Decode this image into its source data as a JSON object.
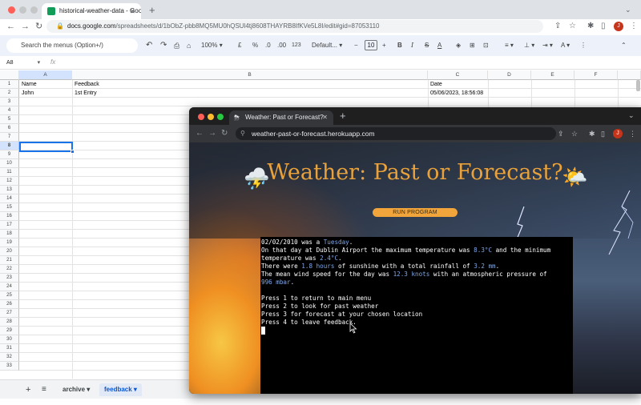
{
  "browser": {
    "tab_title": "historical-weather-data - Goo",
    "url_host": "docs.google.com",
    "url_path": "/spreadsheets/d/1bObZ-pbb8MQ5MU0hQSUl4tj8608THAYRB8IfKVe5L8I/edit#gid=87053110",
    "avatar_letter": "J"
  },
  "sheets": {
    "menu_search": "Search the menus (Option+/)",
    "zoom": "100%",
    "currency": "£",
    "percent": "%",
    "dec_decrease": ".0",
    "dec_increase": ".00",
    "number_format": "123",
    "font": "Default...",
    "font_size": "10",
    "name_box": "A8",
    "fx": "fx",
    "columns": [
      "A",
      "B",
      "C",
      "D",
      "E",
      "F"
    ],
    "rows": [
      "1",
      "2",
      "3",
      "4",
      "5",
      "6",
      "7",
      "8",
      "9",
      "10",
      "11",
      "12",
      "13",
      "14",
      "15",
      "16",
      "17",
      "18",
      "19",
      "20",
      "21",
      "22",
      "23",
      "24",
      "25",
      "26",
      "27",
      "28",
      "29",
      "30",
      "31",
      "32",
      "33"
    ],
    "cells": {
      "a1": "Name",
      "b1": "Feedback",
      "c1": "Date",
      "a2": "John",
      "b2": "1st Entry",
      "c2": "05/06/2023, 18:56:08"
    },
    "sheet_tabs": [
      "archive",
      "feedback"
    ]
  },
  "overlay": {
    "tab_title": "Weather: Past or Forecast?",
    "url": "weather-past-or-forecast.herokuapp.com",
    "avatar_letter": "J",
    "title": "Weather: Past or Forecast?",
    "run_button": "RUN PROGRAM",
    "terminal": {
      "line1_a": "02/02/2010 was a ",
      "line1_day": "Tuesday",
      "line1_b": ".",
      "line2_a": "On that day at Dublin Airport the maximum temperature was ",
      "line2_max": "8.3°C",
      "line2_b": " and the minimum",
      "line3_a": "temperature was ",
      "line3_min": "2.4°C",
      "line3_b": ".",
      "line4_a": "There were ",
      "line4_sun": "1.8 hours",
      "line4_b": " of sunshine with a total rainfall of ",
      "line4_rain": "3.2 mm",
      "line4_c": ".",
      "line5_a": "The mean wind speed for the day was ",
      "line5_wind": "12.3 knots",
      "line5_b": " with an atmospheric pressure of",
      "line6_pressure": "996 mbar",
      "line6_b": ".",
      "menu": [
        "Press 1 to return to main menu",
        "Press 2 to look for past weather",
        "Press 3 for forecast at your chosen location",
        "Press 4 to leave feedback."
      ]
    }
  }
}
